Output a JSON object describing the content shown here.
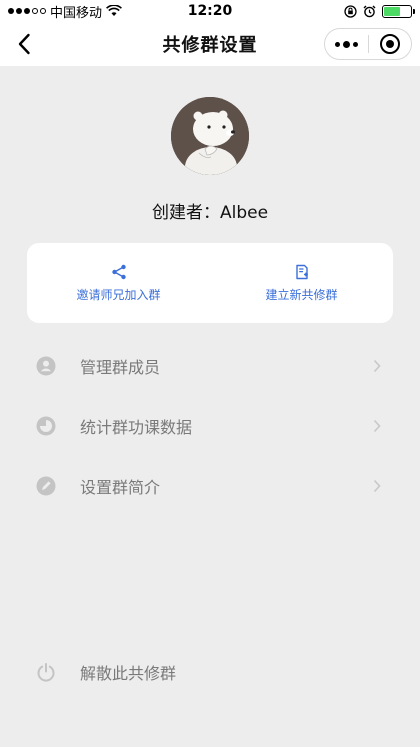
{
  "status_bar": {
    "carrier": "中国移动",
    "time": "12:20",
    "battery_percent": 0.6
  },
  "nav": {
    "title": "共修群设置"
  },
  "creator": {
    "label": "创建者：Albee"
  },
  "actions": [
    {
      "label": "邀请师兄加入群",
      "icon": "share-icon"
    },
    {
      "label": "建立新共修群",
      "icon": "new-document-icon"
    }
  ],
  "menu": [
    {
      "label": "管理群成员",
      "icon": "person-icon"
    },
    {
      "label": "统计群功课数据",
      "icon": "pie-chart-icon"
    },
    {
      "label": "设置群简介",
      "icon": "edit-icon"
    }
  ],
  "disband": {
    "label": "解散此共修群",
    "icon": "power-icon"
  },
  "colors": {
    "accent": "#3b6fd9",
    "background": "#ededed",
    "battery": "#4cd964",
    "menu_text": "#7a7a7a",
    "menu_icon": "#c4c4c4"
  }
}
